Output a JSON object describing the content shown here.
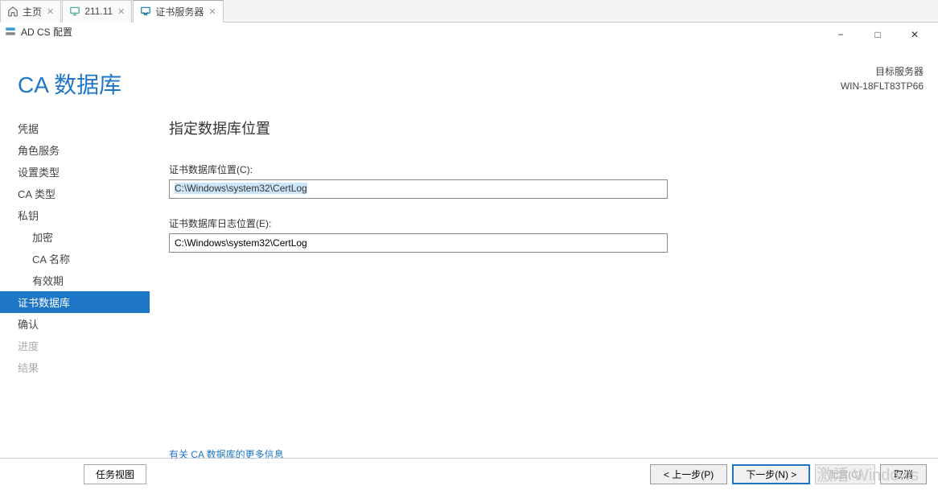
{
  "tabs": [
    {
      "label": "主页",
      "icon": "home"
    },
    {
      "label": "211.11",
      "icon": "monitor"
    },
    {
      "label": "证书服务器",
      "icon": "cert",
      "active": true
    }
  ],
  "window_title": "AD CS 配置",
  "window_controls": {
    "min": "−",
    "max": "□",
    "close": "✕"
  },
  "target_server": {
    "label": "目标服务器",
    "name": "WIN-18FLT83TP66"
  },
  "wizard_title": "CA 数据库",
  "sidebar": {
    "items": [
      {
        "label": "凭据",
        "indent": false
      },
      {
        "label": "角色服务",
        "indent": false
      },
      {
        "label": "设置类型",
        "indent": false
      },
      {
        "label": "CA 类型",
        "indent": false
      },
      {
        "label": "私钥",
        "indent": false
      },
      {
        "label": "加密",
        "indent": true
      },
      {
        "label": "CA 名称",
        "indent": true
      },
      {
        "label": "有效期",
        "indent": true
      },
      {
        "label": "证书数据库",
        "indent": false,
        "selected": true
      },
      {
        "label": "确认",
        "indent": false
      },
      {
        "label": "进度",
        "indent": false,
        "disabled": true
      },
      {
        "label": "结果",
        "indent": false,
        "disabled": true
      }
    ]
  },
  "content": {
    "title": "指定数据库位置",
    "db_location_label": "证书数据库位置(C):",
    "db_location_value": "C:\\Windows\\system32\\CertLog",
    "db_log_label": "证书数据库日志位置(E):",
    "db_log_value": "C:\\Windows\\system32\\CertLog",
    "more_info": "有关 CA 数据库的更多信息"
  },
  "footer": {
    "taskview": "任务视图",
    "prev": "< 上一步(P)",
    "next": "下一步(N) >",
    "config": "配置(C)",
    "cancel": "取消"
  },
  "watermark": "激活 Windows"
}
